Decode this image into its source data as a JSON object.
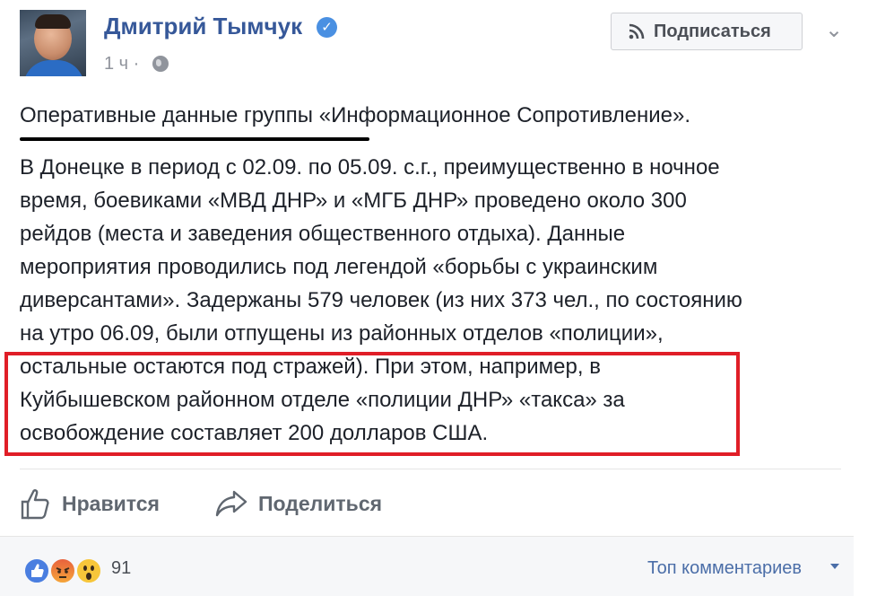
{
  "post": {
    "author": "Дмитрий Тымчук",
    "time": "1 ч ·",
    "follow_label": "Подписаться",
    "more_label": "⌄",
    "verified_mark": "✓",
    "title_line": "Оперативные данные группы «Информационное Сопротивление».",
    "body_lines": [
      "В Донецке в период с 02.09. по 05.09. с.г., преимущественно в ночное",
      "время, боевиками «МВД ДНР» и «МГБ ДНР» проведено около 300",
      "рейдов (места и заведения общественного отдыха). Данные",
      "мероприятия проводились под легендой «борьбы с украинским",
      "диверсантами». Задержаны 579 человек (из них 373 чел., по состоянию",
      "на утро 06.09, были отпущены из районных отделов «полиции»,",
      "остальные остаются под стражей). При этом, например, в",
      "Куйбышевском районном отделе «полиции ДНР» «такса» за",
      "освобождение составляет 200 долларов США."
    ]
  },
  "actions": {
    "like_label": "Нравится",
    "share_label": "Поделиться"
  },
  "footer": {
    "reactions": [
      "like",
      "angry",
      "wow"
    ],
    "reaction_count": "91",
    "sort_label": "Топ комментариев"
  },
  "colors": {
    "author_link": "#365899",
    "highlight_border": "#e01e27",
    "muted": "#90949c"
  },
  "icons": [
    "verified-icon",
    "globe-icon",
    "rss-icon",
    "thumbs-up-icon",
    "share-icon",
    "like-reaction-icon",
    "angry-reaction-icon",
    "wow-reaction-icon",
    "caret-down-icon"
  ]
}
